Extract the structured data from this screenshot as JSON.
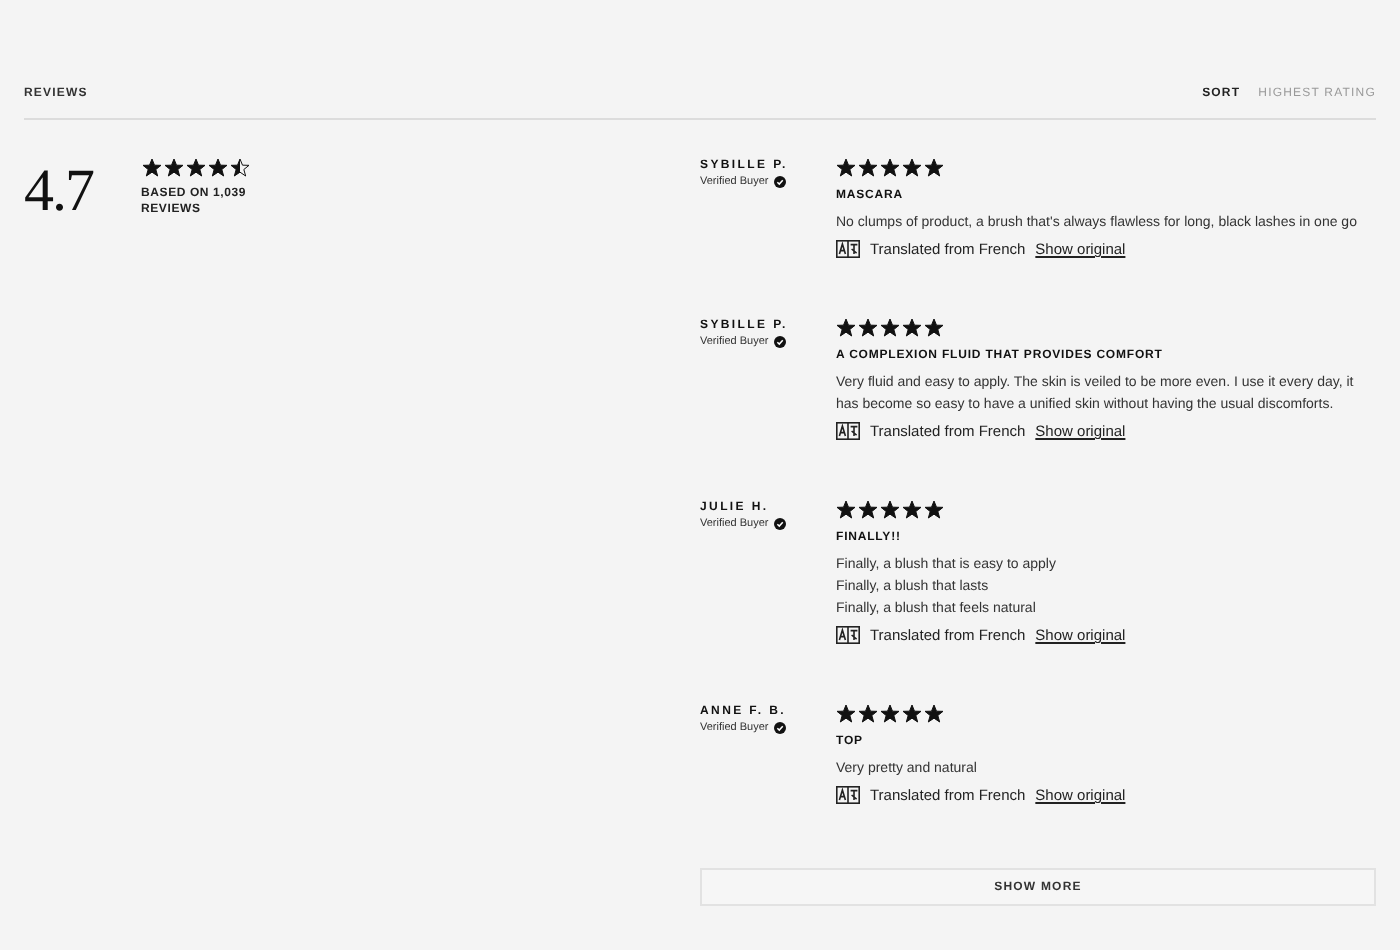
{
  "header": {
    "title": "REVIEWS",
    "sort_label": "SORT",
    "sort_value": "HIGHEST RATING"
  },
  "summary": {
    "rating": "4.7",
    "stars": 4.5,
    "based_on": "BASED ON 1,039 REVIEWS"
  },
  "reviews": [
    {
      "author": "SYBILLE P.",
      "badge": "Verified Buyer",
      "stars": 5,
      "title": "MASCARA",
      "body": [
        "No clumps of product, a brush that's always flawless for long, black lashes in one go"
      ],
      "translation": "Translated from French",
      "link": "Show original"
    },
    {
      "author": "SYBILLE P.",
      "badge": "Verified Buyer",
      "stars": 5,
      "title": "A COMPLEXION FLUID THAT PROVIDES COMFORT",
      "body": [
        "Very fluid and easy to apply. The skin is veiled to be more even. I use it every day, it has become so easy to have a unified skin without having the usual discomforts."
      ],
      "translation": "Translated from French",
      "link": "Show original"
    },
    {
      "author": "JULIE H.",
      "badge": "Verified Buyer",
      "stars": 5,
      "title": "FINALLY!!",
      "body": [
        "Finally, a blush that is easy to apply",
        "Finally, a blush that lasts",
        "Finally, a blush that feels natural"
      ],
      "translation": "Translated from French",
      "link": "Show original"
    },
    {
      "author": "ANNE F. B.",
      "badge": "Verified Buyer",
      "stars": 5,
      "title": "TOP",
      "body": [
        "Very pretty and natural"
      ],
      "translation": "Translated from French",
      "link": "Show original"
    }
  ],
  "show_more": "SHOW MORE"
}
